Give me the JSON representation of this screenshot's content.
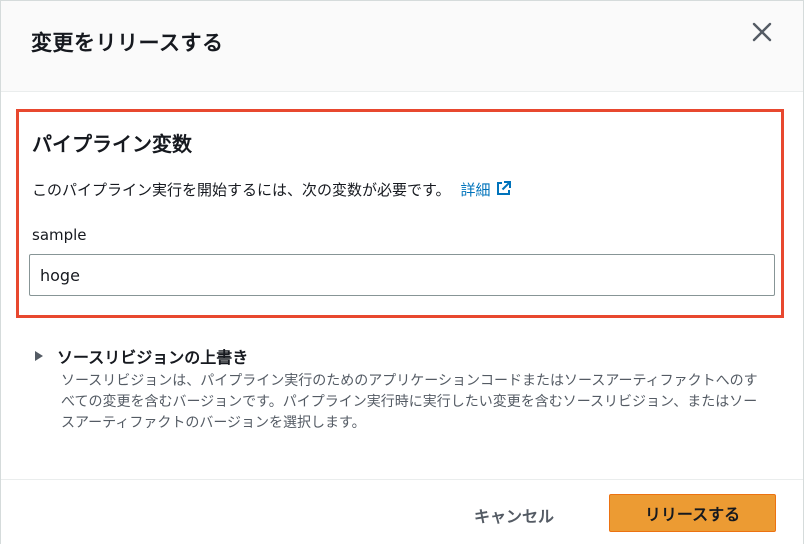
{
  "dialog": {
    "title": "変更をリリースする",
    "close_icon": "close-icon"
  },
  "variables_section": {
    "title": "パイプライン変数",
    "description": "このパイプライン実行を開始するには、次の変数が必要です。",
    "learn_more": "詳細",
    "learn_more_icon": "external-link-icon",
    "field_label": "sample",
    "field_value": "hoge",
    "highlight_color": "#e8482f"
  },
  "source_override": {
    "title": "ソースリビジョンの上書き",
    "description": "ソースリビジョンは、パイプライン実行のためのアプリケーションコードまたはソースアーティファクトへのすべての変更を含むバージョンです。パイプライン実行時に実行したい変更を含むソースリビジョン、またはソースアーティファクトのバージョンを選択します。",
    "expanded": false
  },
  "footer": {
    "cancel_label": "キャンセル",
    "release_label": "リリースする",
    "primary_color": "#ec9b33"
  }
}
